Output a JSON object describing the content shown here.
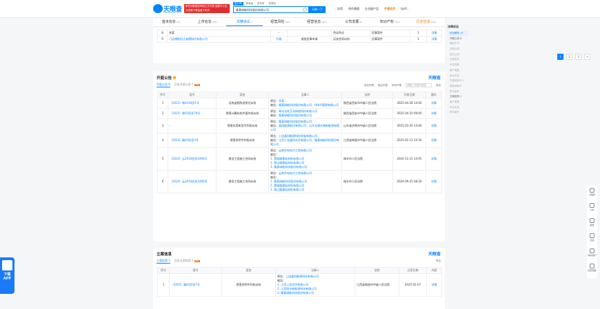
{
  "header": {
    "logo_text": "天眼查",
    "logo_url": "TianYanCha.com",
    "promo": "新在线数据查风险正式开放 国家中小企业发展子基金旗下机构",
    "search_tabs": [
      "查公司",
      "查老板",
      "查关系",
      "查风险"
    ],
    "search_value": "隆基绿能科技股份有限公司",
    "search_button": "天眼一下",
    "nav": [
      "应用",
      "合作通道",
      "企业级产品",
      "开通会员",
      "tyc6..."
    ]
  },
  "tabs": [
    {
      "label": "基本信息",
      "count": "99+"
    },
    {
      "label": "上市信息",
      "count": "999+"
    },
    {
      "label": "法律诉讼",
      "count": "9"
    },
    {
      "label": "经营风险",
      "count": "999+"
    },
    {
      "label": "经营信息",
      "count": "999+"
    },
    {
      "label": "公司发展",
      "count": "30"
    },
    {
      "label": "知识产权",
      "count": "999+"
    },
    {
      "label": "历史信息",
      "count": "999+"
    }
  ],
  "top_table": {
    "rows": [
      [
        "8",
        "李某",
        "-",
        "-",
        "劳动争议",
        "民事案件",
        "1",
        "详情"
      ],
      [
        "9",
        "门店铺股份江省模拟仿有限公司",
        "行政",
        "逸批民事申请",
        "买卖合同纠纷",
        "民事案件",
        "1",
        "详情"
      ]
    ]
  },
  "pagination": [
    "1",
    "2",
    "3",
    ">"
  ],
  "court": {
    "title": "开庭公告",
    "logo": "天眼查",
    "subtabs": [
      "开庭公告 6",
      "历史开庭公告 7"
    ],
    "new_tag": "NEW",
    "filters": [
      "身份不限",
      "案由不限",
      "年份不限"
    ],
    "search_placeholder": "请输入关键字搜索",
    "export": "导出",
    "headers": [
      "序号",
      "案号",
      "案由",
      "当事人",
      "法院",
      "开庭日期",
      "操作"
    ],
    "rows": [
      {
        "no": "1",
        "case": "（2025）陕0116民1号",
        "reason": "证券虚假陈述责任纠纷",
        "parties": [
          "原告：徐某",
          "被告：隆基绿能科技股份有限公司、HHLR管理有限公司"
        ],
        "court": "陕西省西安市中级人民法院",
        "date": "2025-04-28 14:00",
        "op": "详情"
      },
      {
        "no": "2",
        "case": "（2025）陕01民初76号",
        "reason": "侵害计算机软件著作权纠纷",
        "parties": [
          "原告：青岛浩软互动网络科技有限公司",
          "被告：隆基绿能科技股份有限公司"
        ],
        "court": "陕西省西安市中级人民法院",
        "date": "2025-04-10 09:00",
        "op": "详情"
      },
      {
        "no": "3",
        "case": "-",
        "reason": "侵害实用新型专利权纠纷",
        "parties": [
          "原告：隆基绿能科技股份有限公司",
          "被告：晶科能源股份有限公司，山东无锡光储新能源有限公司"
        ],
        "court": "山东省济南市中级人民法院",
        "date": "2025-03-20 14:00",
        "op": "详情"
      },
      {
        "no": "4",
        "case": "（2024）赣01民初3号",
        "reason": "侵害发明专利权纠纷",
        "parties": [
          "原告：上饶晶科能源科技发展有限公司",
          "被告：江西上饶晶科光伏有限公司，隆基绿能科技股份有限公司"
        ],
        "court": "江西省南昌市中级人民法院",
        "date": "2025-02-13 14:30",
        "op": "详情"
      },
      {
        "no": "5",
        "case": "（2024）云2930民初2466号",
        "reason": "建设工程施工合同纠纷",
        "parties": [
          "原告：云南华电电力工程有限公司",
          "被告：",
          "1. 楚雄隆基硅材料有限公司",
          "2. 保山隆基硅材料有限公司",
          "3. 隆基绿能科技股份有限公司"
        ],
        "court": "禄丰市人民法院",
        "date": "2024-11-21 14:45",
        "op": "详情"
      },
      {
        "no": "6",
        "case": "（2024）云2930民初2466号",
        "reason": "建设工程施工合同纠纷",
        "parties": [
          "原告：云南华电电力工程有限公司",
          "被告：",
          "1. 隆基绿能科技股份有限公司",
          "2. 楚雄隆基硅材料有限公司",
          "3. 保山隆基硅材料有限公司"
        ],
        "court": "禄丰市人民法院",
        "date": "2024-09-25 08:30",
        "op": "详情"
      }
    ]
  },
  "filing": {
    "title": "立案信息",
    "logo": "天眼查",
    "subtabs": [
      "立案信息 1",
      "历史立案信息 1"
    ],
    "new_tag": "NEW",
    "export": "导出",
    "headers": [
      "序号",
      "案号",
      "案由",
      "当事人",
      "法院",
      "立案日期",
      "内容"
    ],
    "rows": [
      {
        "no": "1",
        "case": "（2025）赣01民初7号",
        "reason": "侵害发明专利权纠纷",
        "parties": [
          "原告：上饶晶科能源科技有限公司",
          "被告：",
          "1. 江西上饶光伏有限公司",
          "2. 江西阳光新能源科技有限公司",
          "3. 隆基绿能科技股份有限公司"
        ],
        "court": "江西省南昌市中级人民法院",
        "date": "2025-02-07",
        "op": "详情"
      }
    ]
  },
  "side_nav": {
    "title": "法律诉讼",
    "items": [
      "司法解析 10",
      "开庭公告 6",
      "裁判文书",
      "法院公告",
      "送达公告",
      "立案信息",
      "司法协助",
      "破产重整",
      "诉讼关系",
      "失信被执行人",
      "限制消费令",
      "终本案件",
      "立案信息 1",
      "破产重整",
      "诉讼关系",
      "终本案件"
    ]
  },
  "tools": [
    "小程序",
    "APP",
    "报告",
    "反馈",
    "联系我们",
    "回到顶部"
  ],
  "download": {
    "line1": "下载",
    "line2": "APP"
  }
}
